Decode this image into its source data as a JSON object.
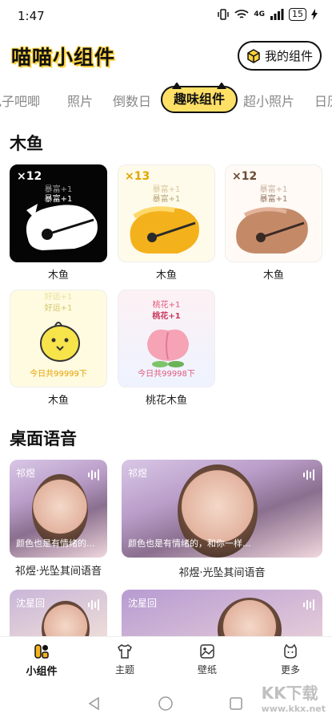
{
  "status": {
    "time": "1:47",
    "battery": "15",
    "signal": "4G"
  },
  "header": {
    "title": "喵喵小组件",
    "my_widgets": "我的组件"
  },
  "tabs": [
    "电子吧唧",
    "照片",
    "倒数日",
    "趣味组件",
    "超小照片",
    "日历"
  ],
  "active_tab": "趣味组件",
  "section_fish": {
    "title": "木鱼"
  },
  "fish": [
    {
      "count": "×12",
      "merit1": "暴富+1",
      "merit2": "暴富+1",
      "label": "木鱼",
      "foot": ""
    },
    {
      "count": "×13",
      "merit1": "暴富+1",
      "merit2": "暴富+1",
      "label": "木鱼",
      "foot": ""
    },
    {
      "count": "×12",
      "merit1": "暴富+1",
      "merit2": "暴富+1",
      "label": "木鱼",
      "foot": ""
    },
    {
      "count": "",
      "merit1": "好运+1",
      "merit2": "好运+1",
      "label": "木鱼",
      "foot": "今日共99999下"
    },
    {
      "count": "",
      "merit1": "桃花+1",
      "merit2": "桃花+1",
      "label": "桃花木鱼",
      "foot": "今日共99998下"
    }
  ],
  "section_voice": {
    "title": "桌面语音"
  },
  "voice": [
    {
      "name": "祁煜",
      "line": "颜色也是有情绪的...",
      "label": "祁煜·光坠其间语音"
    },
    {
      "name": "祁煜",
      "line": "颜色也是有情绪的，和你一样...",
      "label": "祁煜·光坠其间语音"
    },
    {
      "name": "沈星回",
      "line": "",
      "label": ""
    },
    {
      "name": "沈星回",
      "line": "",
      "label": ""
    }
  ],
  "bottom_nav": [
    "小组件",
    "主题",
    "壁纸",
    "更多"
  ],
  "watermark": {
    "big": "KK下载",
    "small": "www.kkx.net"
  },
  "colors": {
    "accent": "#ffe066",
    "title_shadow": "#ffd23c",
    "fish_yellow": "#f3b11c",
    "fish_brown": "#c48a68",
    "peach": "#f6a3b6"
  }
}
